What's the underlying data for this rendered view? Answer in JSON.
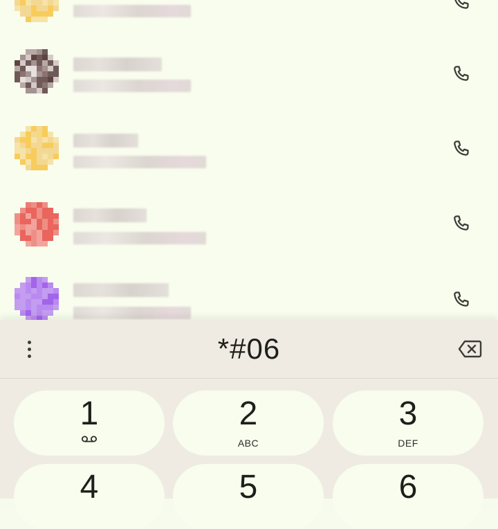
{
  "contacts": [
    {
      "name_hidden": true,
      "palette": "yellow"
    },
    {
      "name_hidden": true,
      "palette": "photo"
    },
    {
      "name_hidden": true,
      "palette": "yellow"
    },
    {
      "name_hidden": true,
      "palette": "red"
    },
    {
      "name_hidden": true,
      "palette": "purple"
    }
  ],
  "icons": {
    "call": "phone-icon",
    "overflow": "more-vertical-icon",
    "backspace": "backspace-icon",
    "voicemail": "voicemail-icon"
  },
  "colors": {
    "background": "#f7fbee",
    "dialer_bar": "#efebe3",
    "key_background": "#f8fdee",
    "text": "#1d1f1a"
  },
  "dialer": {
    "number": "*#06"
  },
  "keypad": {
    "keys": [
      {
        "digit": "1",
        "letters": ""
      },
      {
        "digit": "2",
        "letters": "ABC"
      },
      {
        "digit": "3",
        "letters": "DEF"
      },
      {
        "digit": "4",
        "letters": ""
      },
      {
        "digit": "5",
        "letters": ""
      },
      {
        "digit": "6",
        "letters": ""
      }
    ]
  }
}
